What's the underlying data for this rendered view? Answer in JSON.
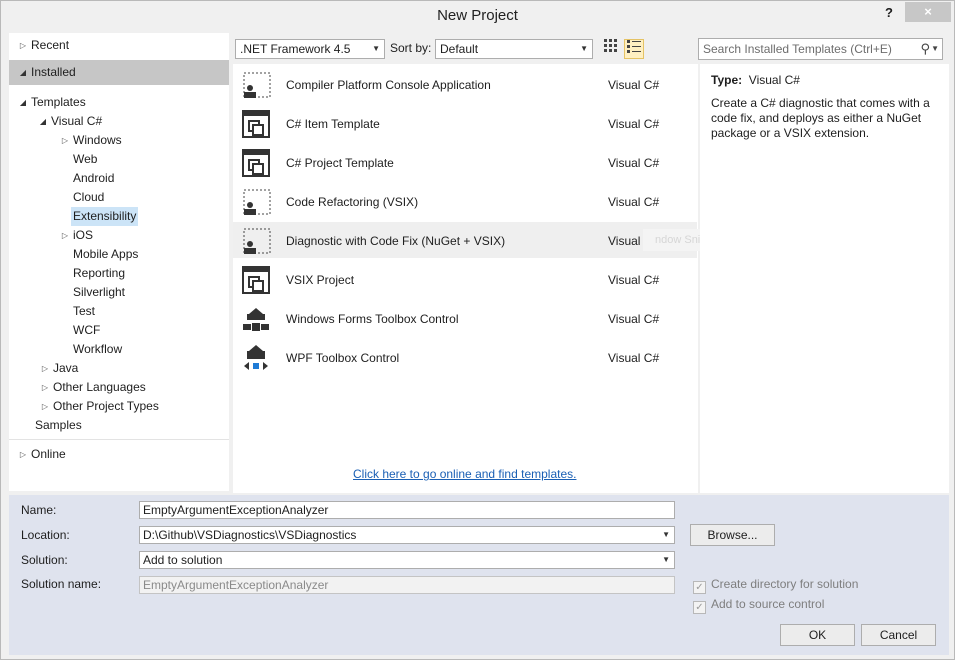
{
  "window": {
    "title": "New Project",
    "help": "?",
    "close": "×"
  },
  "tree": {
    "recent": "Recent",
    "installed": "Installed",
    "templates": "Templates",
    "visual_cs": "Visual C#",
    "children": [
      "Windows",
      "Web",
      "Android",
      "Cloud",
      "Extensibility",
      "iOS",
      "Mobile Apps",
      "Reporting",
      "Silverlight",
      "Test",
      "WCF",
      "Workflow"
    ],
    "java": "Java",
    "other_languages": "Other Languages",
    "other_project_types": "Other Project Types",
    "samples": "Samples",
    "online": "Online"
  },
  "toolbar": {
    "framework": ".NET Framework 4.5",
    "sort_by_label": "Sort by:",
    "sort_by_value": "Default"
  },
  "search": {
    "placeholder": "Search Installed Templates (Ctrl+E)"
  },
  "templates": [
    {
      "name": "Compiler Platform Console Application",
      "lang": "Visual C#",
      "icon": "console-app-icon"
    },
    {
      "name": "C# Item Template",
      "lang": "Visual C#",
      "icon": "item-template-icon"
    },
    {
      "name": "C# Project Template",
      "lang": "Visual C#",
      "icon": "project-template-icon"
    },
    {
      "name": "Code Refactoring (VSIX)",
      "lang": "Visual C#",
      "icon": "refactoring-icon"
    },
    {
      "name": "Diagnostic with Code Fix (NuGet + VSIX)",
      "lang": "Visual C#",
      "icon": "diagnostic-icon"
    },
    {
      "name": "VSIX Project",
      "lang": "Visual C#",
      "icon": "vsix-icon"
    },
    {
      "name": "Windows Forms Toolbox Control",
      "lang": "Visual C#",
      "icon": "winforms-toolbox-icon"
    },
    {
      "name": "WPF Toolbox Control",
      "lang": "Visual C#",
      "icon": "wpf-toolbox-icon"
    }
  ],
  "ghost_text": "ndow Snip",
  "online_link": "Click here to go online and find templates.",
  "description": {
    "type_label": "Type:",
    "type_value": "Visual C#",
    "text": "Create a C# diagnostic that comes with a code fix, and deploys as either a NuGet package or a VSIX extension."
  },
  "form": {
    "name_label": "Name:",
    "name_value": "EmptyArgumentExceptionAnalyzer",
    "location_label": "Location:",
    "location_value": "D:\\Github\\VSDiagnostics\\VSDiagnostics",
    "browse": "Browse...",
    "solution_label": "Solution:",
    "solution_value": "Add to solution",
    "solution_name_label": "Solution name:",
    "solution_name_value": "EmptyArgumentExceptionAnalyzer",
    "create_dir": "Create directory for solution",
    "source_control": "Add to source control",
    "ok": "OK",
    "cancel": "Cancel"
  },
  "colors": {
    "installed_band": "#c6c6c6",
    "selected_item": "#cce4f7",
    "link": "#1a5fb4",
    "form_bg": "#dfe3ee"
  }
}
